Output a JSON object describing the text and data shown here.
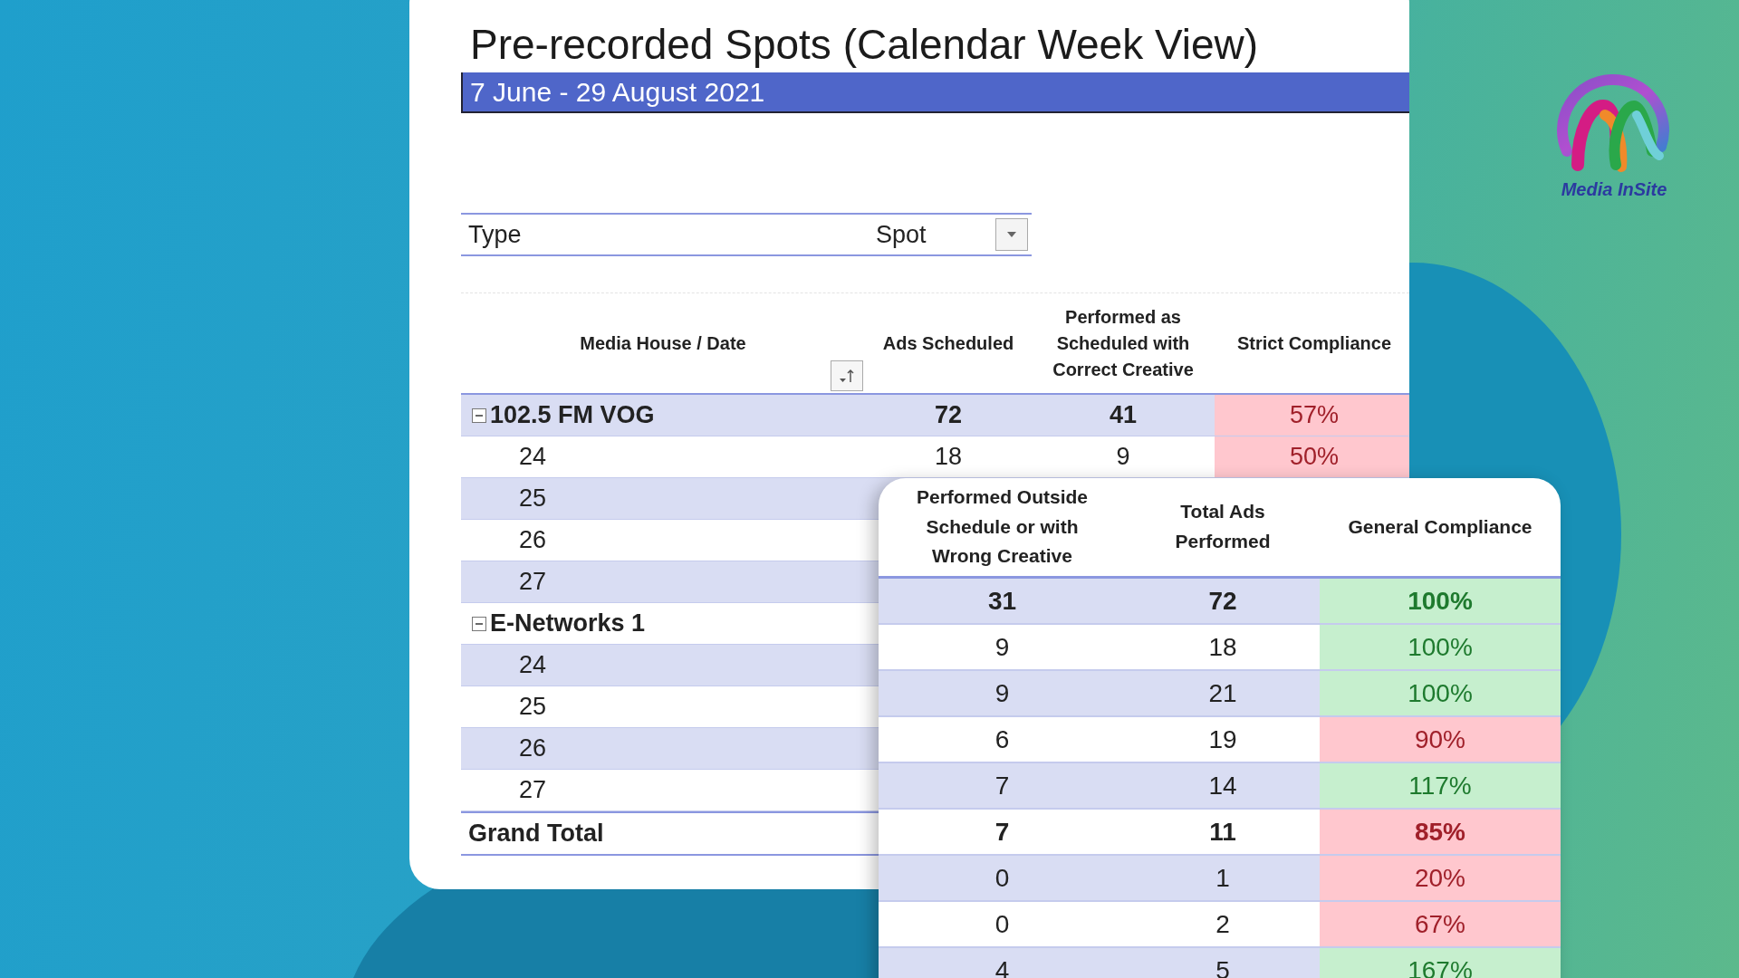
{
  "report": {
    "title": "Pre-recorded Spots (Calendar Week View)",
    "date_range": "7 June - 29 August 2021",
    "filter": {
      "label": "Type",
      "value": "Spot"
    },
    "columns": [
      "Media House / Date",
      "Ads Scheduled",
      "Performed as Scheduled with Correct Creative",
      "Strict Compliance"
    ],
    "rows": [
      {
        "kind": "group",
        "label": "102.5 FM VOG",
        "expanded": true,
        "ads_scheduled": "72",
        "performed_as_scheduled": "41",
        "strict_compliance": "57%",
        "compliant": false
      },
      {
        "kind": "item",
        "label": "24",
        "ads_scheduled": "18",
        "performed_as_scheduled": "9",
        "strict_compliance": "50%",
        "compliant": false
      },
      {
        "kind": "item",
        "label": "25"
      },
      {
        "kind": "item",
        "label": "26"
      },
      {
        "kind": "item",
        "label": "27"
      },
      {
        "kind": "group",
        "label": "E-Networks 1",
        "expanded": true
      },
      {
        "kind": "item",
        "label": "24"
      },
      {
        "kind": "item",
        "label": "25"
      },
      {
        "kind": "item",
        "label": "26"
      },
      {
        "kind": "item",
        "label": "27"
      },
      {
        "kind": "total",
        "label": "Grand Total"
      }
    ]
  },
  "detail": {
    "columns": [
      "Performed Outside Schedule or with Wrong Creative",
      "Total Ads Performed",
      "General Compliance"
    ],
    "rows": [
      {
        "kind": "group",
        "outside": "31",
        "total": "72",
        "general_compliance": "100%",
        "compliant": true
      },
      {
        "kind": "item",
        "outside": "9",
        "total": "18",
        "general_compliance": "100%",
        "compliant": true
      },
      {
        "kind": "item",
        "outside": "9",
        "total": "21",
        "general_compliance": "100%",
        "compliant": true
      },
      {
        "kind": "item",
        "outside": "6",
        "total": "19",
        "general_compliance": "90%",
        "compliant": false
      },
      {
        "kind": "item",
        "outside": "7",
        "total": "14",
        "general_compliance": "117%",
        "compliant": true
      },
      {
        "kind": "group",
        "outside": "7",
        "total": "11",
        "general_compliance": "85%",
        "compliant": false
      },
      {
        "kind": "item",
        "outside": "0",
        "total": "1",
        "general_compliance": "20%",
        "compliant": false
      },
      {
        "kind": "item",
        "outside": "0",
        "total": "2",
        "general_compliance": "67%",
        "compliant": false
      },
      {
        "kind": "item",
        "outside": "4",
        "total": "5",
        "general_compliance": "167%",
        "compliant": true
      }
    ]
  },
  "logo": {
    "text": "Media InSite"
  }
}
